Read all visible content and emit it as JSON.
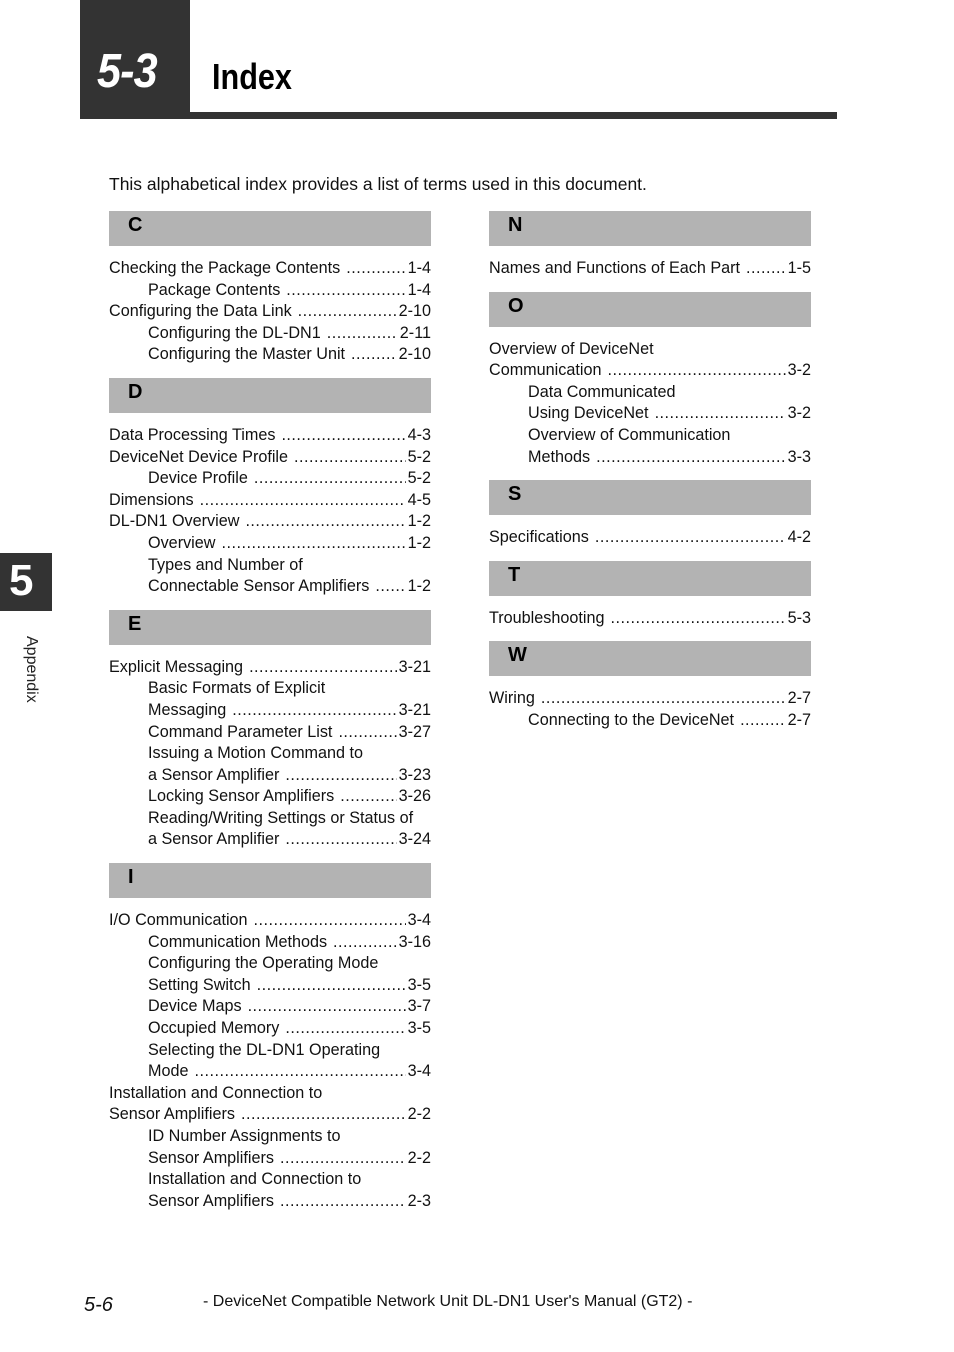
{
  "header": {
    "chapter_number": "5-3",
    "title": "Index"
  },
  "intro": "This alphabetical index provides a list of terms used in this document.",
  "columns": [
    {
      "sections": [
        {
          "letter": "C",
          "entries": [
            {
              "text": "Checking the Package Contents",
              "page": "1-4",
              "level": 0
            },
            {
              "text": "Package Contents",
              "page": "1-4",
              "level": 1
            },
            {
              "text": "Configuring the Data Link",
              "page": "2-10",
              "level": 0
            },
            {
              "text": "Configuring the DL-DN1",
              "page": "2-11",
              "level": 1
            },
            {
              "text": "Configuring the Master Unit",
              "page": "2-10",
              "level": 1
            }
          ]
        },
        {
          "letter": "D",
          "entries": [
            {
              "text": "Data Processing Times",
              "page": "4-3",
              "level": 0
            },
            {
              "text": "DeviceNet Device Profile",
              "page": "5-2",
              "level": 0
            },
            {
              "text": "Device Profile",
              "page": "5-2",
              "level": 1
            },
            {
              "text": "Dimensions",
              "page": "4-5",
              "level": 0
            },
            {
              "text": "DL-DN1 Overview",
              "page": "1-2",
              "level": 0
            },
            {
              "text": "Overview",
              "page": "1-2",
              "level": 1
            },
            {
              "text": "Types and Number of",
              "page": "",
              "level": 1
            },
            {
              "text": "Connectable Sensor Amplifiers",
              "page": "1-2",
              "level": 1
            }
          ]
        },
        {
          "letter": "E",
          "entries": [
            {
              "text": "Explicit Messaging",
              "page": "3-21",
              "level": 0
            },
            {
              "text": "Basic Formats of Explicit",
              "page": "",
              "level": 1
            },
            {
              "text": "Messaging",
              "page": "3-21",
              "level": 1
            },
            {
              "text": "Command Parameter List",
              "page": "3-27",
              "level": 1
            },
            {
              "text": "Issuing a Motion Command to",
              "page": "",
              "level": 1
            },
            {
              "text": "a Sensor Amplifier",
              "page": "3-23",
              "level": 1
            },
            {
              "text": "Locking Sensor Amplifiers",
              "page": "3-26",
              "level": 1
            },
            {
              "text": "Reading/Writing Settings or Status of",
              "page": "",
              "level": 1
            },
            {
              "text": "a Sensor Amplifier",
              "page": "3-24",
              "level": 1
            }
          ]
        },
        {
          "letter": "I",
          "entries": [
            {
              "text": "I/O Communication",
              "page": "3-4",
              "level": 0
            },
            {
              "text": "Communication Methods",
              "page": "3-16",
              "level": 1
            },
            {
              "text": "Configuring the Operating Mode",
              "page": "",
              "level": 1
            },
            {
              "text": "Setting Switch",
              "page": "3-5",
              "level": 1
            },
            {
              "text": "Device Maps",
              "page": "3-7",
              "level": 1
            },
            {
              "text": "Occupied Memory",
              "page": "3-5",
              "level": 1
            },
            {
              "text": "Selecting the DL-DN1 Operating",
              "page": "",
              "level": 1
            },
            {
              "text": "Mode",
              "page": "3-4",
              "level": 1
            },
            {
              "text": "Installation and Connection to",
              "page": "",
              "level": 0
            },
            {
              "text": "Sensor Amplifiers",
              "page": "2-2",
              "level": 0
            },
            {
              "text": "ID Number Assignments to",
              "page": "",
              "level": 1
            },
            {
              "text": "Sensor Amplifiers",
              "page": "2-2",
              "level": 1
            },
            {
              "text": "Installation and Connection to",
              "page": "",
              "level": 1
            },
            {
              "text": "Sensor Amplifiers",
              "page": "2-3",
              "level": 1
            }
          ]
        }
      ]
    },
    {
      "sections": [
        {
          "letter": "N",
          "entries": [
            {
              "text": "Names and Functions of Each Part",
              "page": "1-5",
              "level": 0
            }
          ]
        },
        {
          "letter": "O",
          "entries": [
            {
              "text": "Overview of DeviceNet",
              "page": "",
              "level": 0
            },
            {
              "text": "Communication",
              "page": "3-2",
              "level": 0
            },
            {
              "text": "Data Communicated",
              "page": "",
              "level": 1
            },
            {
              "text": "Using DeviceNet",
              "page": "3-2",
              "level": 1
            },
            {
              "text": "Overview of Communication",
              "page": "",
              "level": 1
            },
            {
              "text": "Methods",
              "page": "3-3",
              "level": 1
            }
          ]
        },
        {
          "letter": "S",
          "entries": [
            {
              "text": "Specifications",
              "page": "4-2",
              "level": 0
            }
          ]
        },
        {
          "letter": "T",
          "entries": [
            {
              "text": "Troubleshooting",
              "page": "5-3",
              "level": 0
            }
          ]
        },
        {
          "letter": "W",
          "entries": [
            {
              "text": "Wiring",
              "page": "2-7",
              "level": 0
            },
            {
              "text": "Connecting to the DeviceNet",
              "page": "2-7",
              "level": 1
            }
          ]
        }
      ]
    }
  ],
  "side_tab": {
    "number": "5",
    "label": "Appendix"
  },
  "footer": {
    "page_number": "5-6",
    "manual_title": "- DeviceNet Compatible Network Unit DL-DN1 User's Manual (GT2) -"
  }
}
